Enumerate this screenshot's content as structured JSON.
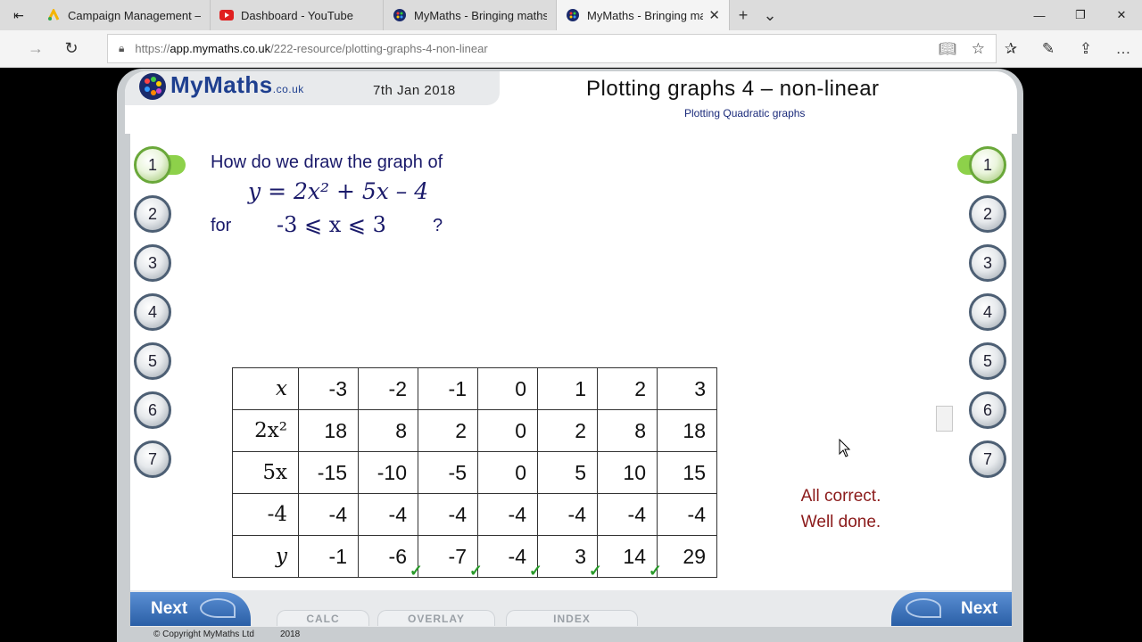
{
  "browser": {
    "tabs": [
      {
        "title": "Campaign Management – G",
        "icon": "google-ads-icon"
      },
      {
        "title": "Dashboard - YouTube",
        "icon": "youtube-icon"
      },
      {
        "title": "MyMaths - Bringing maths",
        "icon": "mymaths-icon"
      },
      {
        "title": "MyMaths - Bringing ma",
        "icon": "mymaths-icon",
        "active": true
      }
    ],
    "url_prefix": "https://",
    "url_domain": "app.mymaths.co.uk",
    "url_path": "/222-resource/plotting-graphs-4-non-linear"
  },
  "header": {
    "logo_text": "MyMaths",
    "logo_suffix": ".co.uk",
    "date": "7th Jan 2018",
    "title": "Plotting graphs 4 – non-linear",
    "subtitle": "Plotting Quadratic graphs"
  },
  "nav": {
    "left": [
      "1",
      "2",
      "3",
      "4",
      "5",
      "6",
      "7"
    ],
    "right": [
      "1",
      "2",
      "3",
      "4",
      "5",
      "6",
      "7"
    ],
    "active": "1"
  },
  "question": {
    "line1": "How do we draw the graph of",
    "equation": "y = 2x² + 5x – 4",
    "for_label": "for",
    "range": "-3 ⩽ x ⩽ 3",
    "qmark": "?"
  },
  "table": {
    "rows": [
      {
        "label": "x",
        "values": [
          "-3",
          "-2",
          "-1",
          "0",
          "1",
          "2",
          "3"
        ]
      },
      {
        "label": "2x²",
        "values": [
          "18",
          "8",
          "2",
          "0",
          "2",
          "8",
          "18"
        ]
      },
      {
        "label": "5x",
        "values": [
          "-15",
          "-10",
          "-5",
          "0",
          "5",
          "10",
          "15"
        ]
      },
      {
        "label": "-4",
        "values": [
          "-4",
          "-4",
          "-4",
          "-4",
          "-4",
          "-4",
          "-4"
        ]
      },
      {
        "label": "y",
        "values": [
          "-1",
          "-6",
          "-7",
          "-4",
          "3",
          "14",
          "29"
        ],
        "ticked": [
          false,
          true,
          true,
          true,
          true,
          true,
          false
        ]
      }
    ]
  },
  "feedback": {
    "line1": "All correct.",
    "line2": "Well done."
  },
  "footer": {
    "next_label": "Next",
    "calc_label": "CALC",
    "overlay_label": "OVERLAY",
    "index_label": "INDEX",
    "copyright": "© Copyright MyMaths Ltd",
    "year": "2018"
  },
  "colors": {
    "accent_green": "#8dd14a",
    "feedback_red": "#8b1a1a",
    "brand_blue": "#1e3f8f"
  }
}
